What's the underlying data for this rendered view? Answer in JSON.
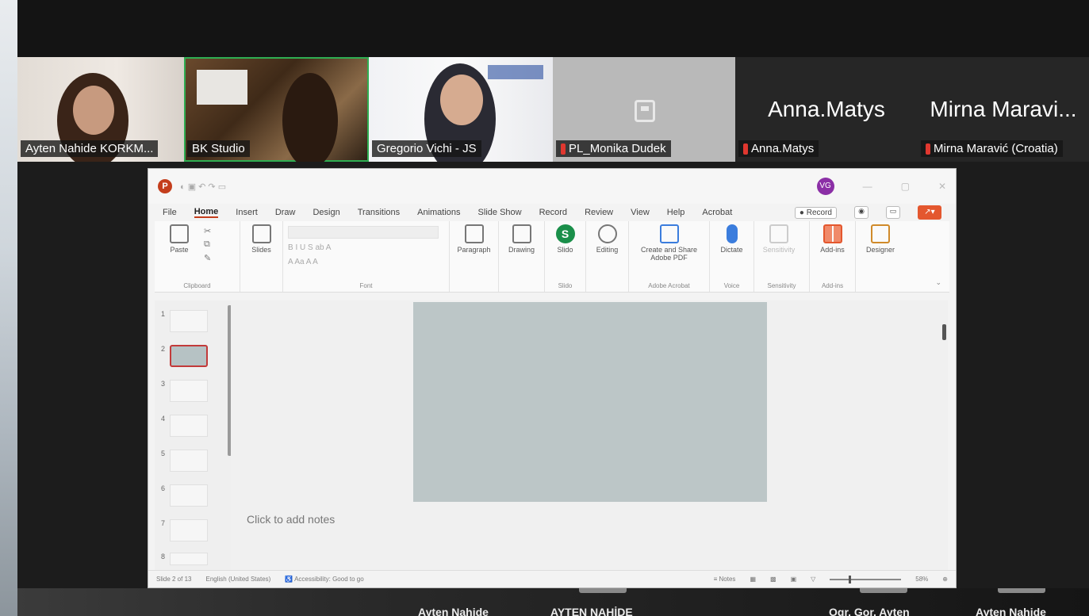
{
  "participants": [
    {
      "name": "Ayten Nahide KORKM...",
      "kind": "video"
    },
    {
      "name": "BK Studio",
      "kind": "video",
      "active_speaker": true
    },
    {
      "name": "Gregorio Vichi - JS",
      "kind": "video"
    },
    {
      "name": "PL_Monika Dudek",
      "kind": "avatar",
      "muted": true
    },
    {
      "display_name": "Anna.Matys",
      "name": "Anna.Matys",
      "kind": "name",
      "muted": true
    },
    {
      "display_name": "Mirna Maravi...",
      "name": "Mirna Maravić (Croatia)",
      "kind": "name",
      "muted": true
    }
  ],
  "powerpoint": {
    "menu": [
      "File",
      "Home",
      "Insert",
      "Draw",
      "Design",
      "Transitions",
      "Animations",
      "Slide Show",
      "Record",
      "Review",
      "View",
      "Help",
      "Acrobat"
    ],
    "active_menu": "Home",
    "record_label": "Record",
    "user_initials": "VG",
    "ribbon": {
      "clipboard": {
        "label": "Clipboard",
        "paste": "Paste"
      },
      "slides": {
        "new_slide": "Slides"
      },
      "font": {
        "label": "Font"
      },
      "paragraph": "Paragraph",
      "drawing": "Drawing",
      "slido": {
        "button": "Slido",
        "label": "Slido"
      },
      "editing": "Editing",
      "acrobat": {
        "button": "Create and Share Adobe PDF",
        "label": "Adobe Acrobat"
      },
      "voice": {
        "button": "Dictate",
        "label": "Voice"
      },
      "sensitivity": {
        "button": "Sensitivity",
        "label": "Sensitivity"
      },
      "addins": {
        "button": "Add-ins",
        "label": "Add-ins"
      },
      "designer": "Designer"
    },
    "thumbnails": [
      "1",
      "2",
      "3",
      "4",
      "5",
      "6",
      "7",
      "8"
    ],
    "selected_slide": 2,
    "notes_placeholder": "Click to add notes",
    "status": {
      "slide_of": "Slide 2 of 13",
      "language": "English (United States)",
      "accessibility": "Accessibility: Good to go",
      "notes": "Notes",
      "zoom": "58%"
    }
  },
  "bottom_names": [
    "Ayten Nahide",
    "AYTEN NAHİDE",
    "Ogr. Gor. Ayten",
    "Ayten Nahide"
  ],
  "colors": {
    "active_speaker_border": "#2fae52",
    "mic_off": "#e0372f",
    "ppt_accent": "#c43e1c",
    "slide_bg": "#bcc6c7"
  }
}
